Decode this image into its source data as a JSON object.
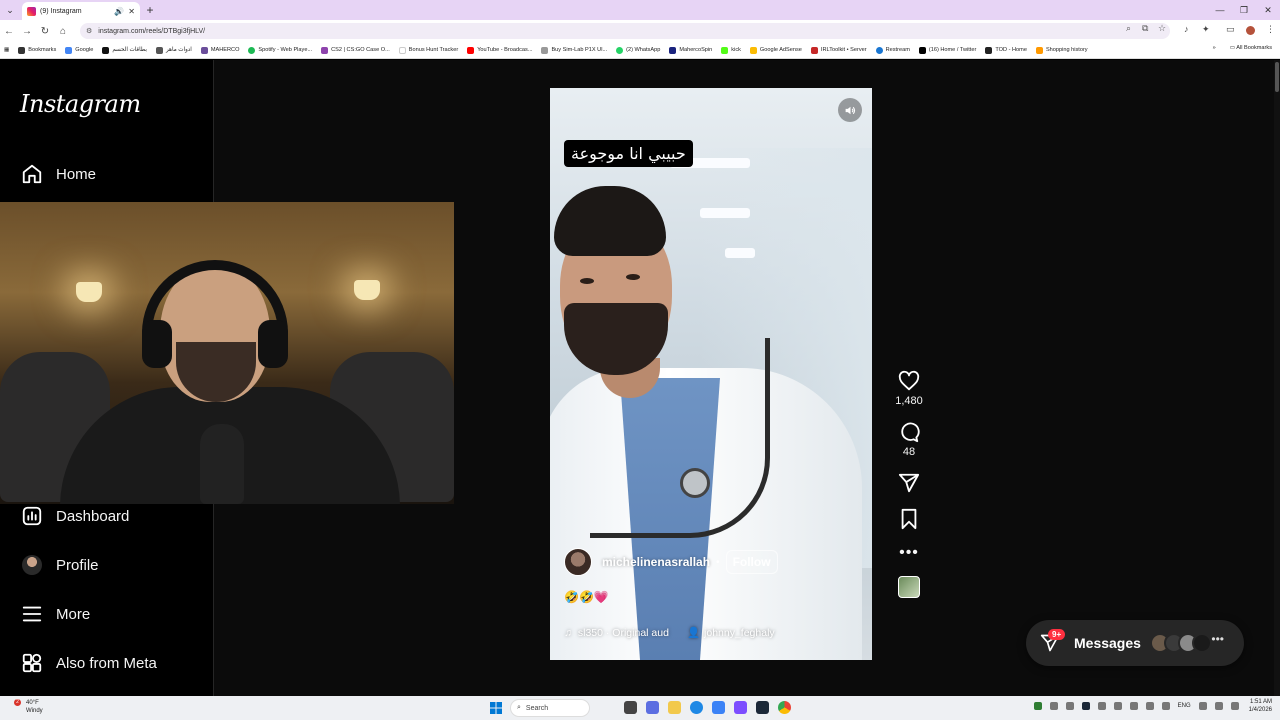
{
  "browser": {
    "tab_title": "(9) Instagram",
    "url": "instagram.com/reels/DTBgi3fjHLV/",
    "bookmarks": [
      "Bookmarks",
      "Google",
      "بطاقات الحسم",
      "ادوات ماهر",
      "MAHERCO",
      "Spotify - Web Playe...",
      "CS2 | CS:GO Case O...",
      "Bonus Hunt Tracker",
      "YouTube - Broadcas...",
      "Buy Sim-Lab P1X Ul...",
      "(2) WhatsApp",
      "MahercoSpin",
      "kick",
      "Google AdSense",
      "IRLToolkit • Server",
      "Restream",
      "(16) Home / Twitter",
      "TOD - Home",
      "Shopping history"
    ],
    "all_bookmarks": "All Bookmarks"
  },
  "instagram": {
    "logo": "Instagram",
    "nav": {
      "home": "Home",
      "dashboard": "Dashboard",
      "profile": "Profile",
      "more": "More",
      "also_from_meta": "Also from Meta"
    },
    "reel": {
      "overlay_text": "حبيبي انا موجوعة",
      "username": "michelinenasrallah",
      "separator": "•",
      "follow": "Follow",
      "caption": "🤣🤣💗",
      "audio": "sl350 · Original aud",
      "tagged_user": "johnny_feghaly"
    },
    "actions": {
      "likes": "1,480",
      "comments": "48"
    },
    "messages": {
      "label": "Messages",
      "badge": "9+"
    }
  },
  "taskbar": {
    "temp": "40°F",
    "weather": "Windy",
    "weather_badge": "2",
    "search": "Search",
    "language": "ENG",
    "time": "1:51 AM",
    "date": "1/4/2026"
  }
}
